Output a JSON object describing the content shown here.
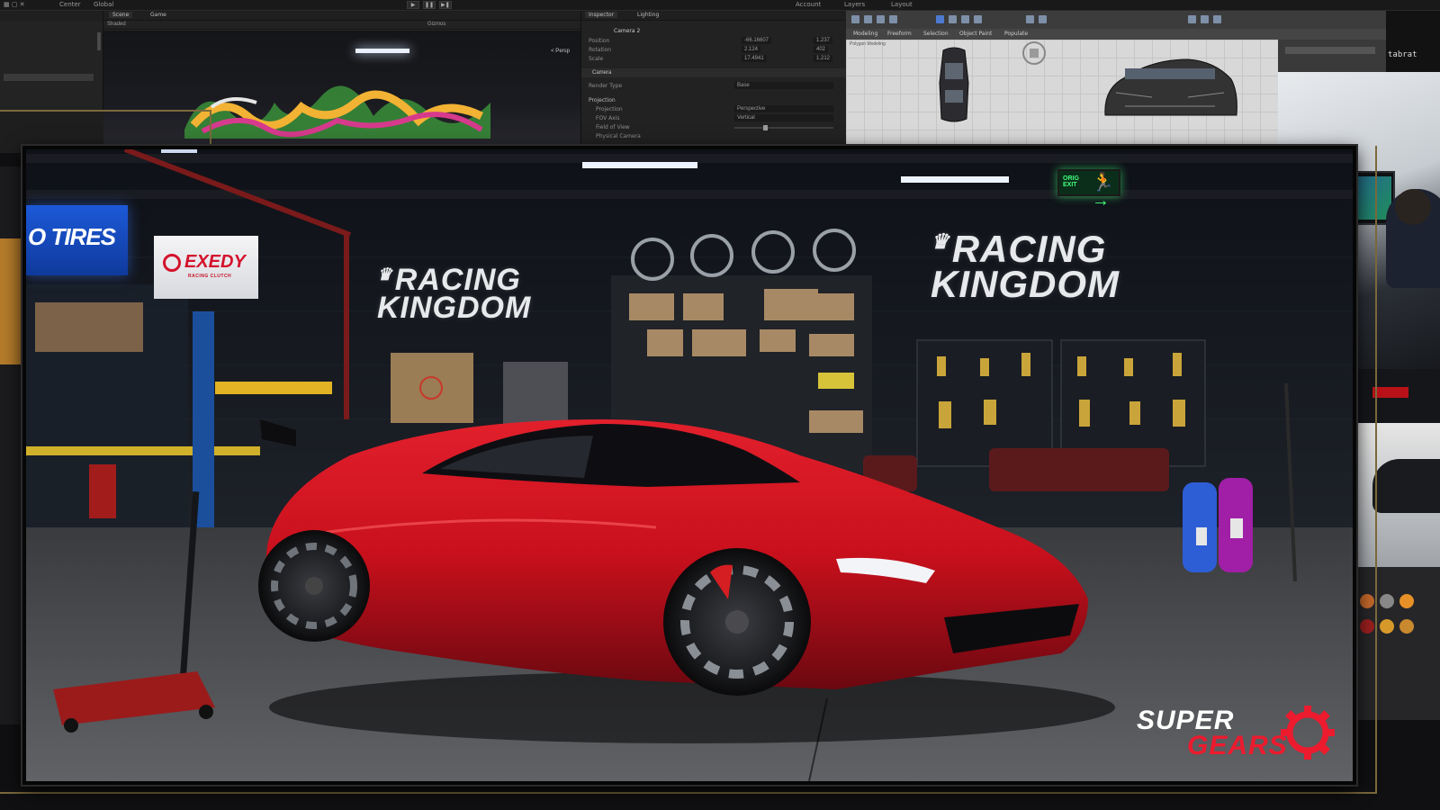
{
  "editor": {
    "menubar": {
      "left_items": [
        "Center",
        "Global"
      ],
      "right_items": [
        "Account",
        "Layers",
        "Layout"
      ]
    },
    "scene_tabs": [
      "Scene",
      "Game"
    ],
    "scene_toolbar": {
      "shading": "Shaded",
      "gizmos": "Gizmos",
      "persp": "< Persp"
    },
    "inspector": {
      "tabs": [
        "Inspector",
        "Lighting"
      ],
      "object_name": "Camera 2",
      "rows": [
        {
          "label": "Position",
          "x": "-66.16607",
          "y": "1.237"
        },
        {
          "label": "Rotation",
          "x": "2.124",
          "y": "402"
        },
        {
          "label": "Scale",
          "x": "17.4941",
          "y": "1.212"
        }
      ],
      "component": "Camera",
      "render_type_label": "Render Type",
      "render_type_value": "Base",
      "projection_head": "Projection",
      "projection_label": "Projection",
      "projection_value": "Perspective",
      "fov_axis_label": "FOV Axis",
      "fov_axis_value": "Vertical",
      "fov_label": "Field of View",
      "physical_label": "Physical Camera"
    },
    "max_toolbar2": [
      "Modeling",
      "Freeform",
      "Selection",
      "Object Paint",
      "Populate"
    ],
    "max_sub": "Polygon Modeling",
    "side_label": "tabrat"
  },
  "game": {
    "tires_sign": "O TIRES",
    "exedy": {
      "name": "EXEDY",
      "sub": "RACING CLUTCH"
    },
    "racing_kingdom": {
      "line1": "RACING",
      "line2": "KINGDOM"
    },
    "exit": {
      "line1": "ORIG",
      "line2": "EXIT"
    },
    "brand": {
      "line1": "SUPER",
      "line2": "GEARS"
    }
  },
  "colors": {
    "car_red": "#c8101c",
    "brand_red": "#ec1b2e",
    "exit_green": "#41ff7d",
    "tires_blue": "#1c59d8",
    "frame_gold": "#7c6a3d"
  }
}
